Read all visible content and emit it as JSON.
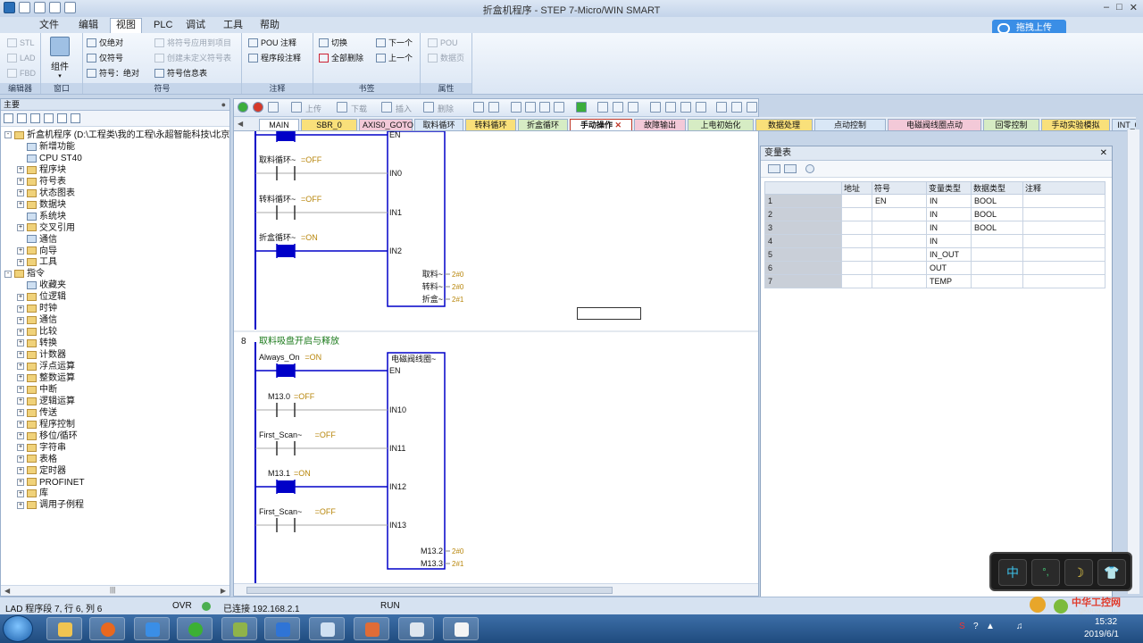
{
  "window": {
    "title": "折盒机程序 - STEP 7-Micro/WIN SMART",
    "minimize_icon": "minimize-icon",
    "maximize_icon": "maximize-icon",
    "close_icon": "close-icon"
  },
  "menu": [
    "文件",
    "编辑",
    "视图",
    "PLC",
    "调试",
    "工具",
    "帮助"
  ],
  "cloud_button": "拖拽上传",
  "ribbon": {
    "editor_group": {
      "label": "编辑器",
      "items": [
        "STL",
        "LAD",
        "FBD"
      ]
    },
    "window_group": {
      "label": "窗口",
      "big": "组件"
    },
    "symbol_group": {
      "label": "符号",
      "items": [
        "仅绝对",
        "仅符号",
        "符号：绝对",
        "将符号应用到项目",
        "创建未定义符号表",
        "符号信息表"
      ]
    },
    "comment_group": {
      "label": "注释",
      "items": [
        "POU 注释",
        "程序段注释"
      ]
    },
    "bookmark_group": {
      "label": "书签",
      "items": [
        "切换",
        "全部删除",
        "下一个",
        "上一个"
      ]
    },
    "property_group": {
      "label": "属性",
      "items": [
        "POU",
        "数据页"
      ]
    }
  },
  "left_panel": {
    "title": "主要",
    "tree": [
      {
        "label": "折盒机程序 (D:\\工程类\\我的工程\\永超智能科技\\北京",
        "level": 0,
        "exp": "-"
      },
      {
        "label": "新增功能",
        "level": 1,
        "exp": ""
      },
      {
        "label": "CPU ST40",
        "level": 1,
        "exp": ""
      },
      {
        "label": "程序块",
        "level": 1,
        "exp": "+"
      },
      {
        "label": "符号表",
        "level": 1,
        "exp": "+"
      },
      {
        "label": "状态图表",
        "level": 1,
        "exp": "+"
      },
      {
        "label": "数据块",
        "level": 1,
        "exp": "+"
      },
      {
        "label": "系统块",
        "level": 1,
        "exp": ""
      },
      {
        "label": "交叉引用",
        "level": 1,
        "exp": "+"
      },
      {
        "label": "通信",
        "level": 1,
        "exp": ""
      },
      {
        "label": "向导",
        "level": 1,
        "exp": "+"
      },
      {
        "label": "工具",
        "level": 1,
        "exp": "+"
      },
      {
        "label": "指令",
        "level": 0,
        "exp": "-"
      },
      {
        "label": "收藏夹",
        "level": 1,
        "exp": ""
      },
      {
        "label": "位逻辑",
        "level": 1,
        "exp": "+"
      },
      {
        "label": "时钟",
        "level": 1,
        "exp": "+"
      },
      {
        "label": "通信",
        "level": 1,
        "exp": "+"
      },
      {
        "label": "比较",
        "level": 1,
        "exp": "+"
      },
      {
        "label": "转换",
        "level": 1,
        "exp": "+"
      },
      {
        "label": "计数器",
        "level": 1,
        "exp": "+"
      },
      {
        "label": "浮点运算",
        "level": 1,
        "exp": "+"
      },
      {
        "label": "整数运算",
        "level": 1,
        "exp": "+"
      },
      {
        "label": "中断",
        "level": 1,
        "exp": "+"
      },
      {
        "label": "逻辑运算",
        "level": 1,
        "exp": "+"
      },
      {
        "label": "传送",
        "level": 1,
        "exp": "+"
      },
      {
        "label": "程序控制",
        "level": 1,
        "exp": "+"
      },
      {
        "label": "移位/循环",
        "level": 1,
        "exp": "+"
      },
      {
        "label": "字符串",
        "level": 1,
        "exp": "+"
      },
      {
        "label": "表格",
        "level": 1,
        "exp": "+"
      },
      {
        "label": "定时器",
        "level": 1,
        "exp": "+"
      },
      {
        "label": "PROFINET",
        "level": 1,
        "exp": "+"
      },
      {
        "label": "库",
        "level": 1,
        "exp": "+"
      },
      {
        "label": "调用子例程",
        "level": 1,
        "exp": "+"
      }
    ]
  },
  "editor_toolbar": {
    "upload": "上传",
    "download": "下载",
    "insert": "插入",
    "delete": "删除"
  },
  "tabs": [
    {
      "label": "MAIN",
      "color": "#ffffff"
    },
    {
      "label": "SBR_0",
      "color": "#f9e07a"
    },
    {
      "label": "AXIS0_GOTO",
      "color": "#f3c9d8"
    },
    {
      "label": "取料循环",
      "color": "#d9e7f6"
    },
    {
      "label": "转料循环",
      "color": "#f9e07a"
    },
    {
      "label": "折盒循环",
      "color": "#d6ecc4"
    },
    {
      "label": "手动操作",
      "color": "#ffffff",
      "active": true
    },
    {
      "label": "故障输出",
      "color": "#f3c9d8"
    },
    {
      "label": "上电初始化",
      "color": "#d6ecc4"
    },
    {
      "label": "数据处理",
      "color": "#f9e07a"
    },
    {
      "label": "点动控制",
      "color": "#d9e7f6"
    },
    {
      "label": "电磁阀线圈点动",
      "color": "#f3c9d8"
    },
    {
      "label": "回零控制",
      "color": "#d6ecc4"
    },
    {
      "label": "手动实验模拟",
      "color": "#f9e07a"
    },
    {
      "label": "INT_0",
      "color": "#d9e7f6"
    }
  ],
  "ladder": {
    "network7": {
      "box_inputs": [
        "EN",
        "IN0",
        "IN1",
        "IN2"
      ],
      "contacts": [
        {
          "label": "取料循环~",
          "state": "=OFF",
          "on": false
        },
        {
          "label": "转料循环~",
          "state": "=OFF",
          "on": false
        },
        {
          "label": "折盒循环~",
          "state": "=ON",
          "on": true
        }
      ],
      "outputs": [
        {
          "label": "取料~",
          "value": "2#0"
        },
        {
          "label": "转料~",
          "value": "2#0"
        },
        {
          "label": "折盒~",
          "value": "2#1"
        }
      ]
    },
    "network8": {
      "number": "8",
      "title": "取料吸盘开启与释放",
      "box_name": "电磁阀线圈~",
      "box_inputs": [
        "EN",
        "IN10",
        "IN11",
        "IN12",
        "IN13"
      ],
      "contacts": [
        {
          "label": "Always_On",
          "state": "=ON",
          "on": true
        },
        {
          "label": "M13.0",
          "state": "=OFF",
          "on": false
        },
        {
          "label": "First_Scan~",
          "state": "=OFF",
          "on": false
        },
        {
          "label": "M13.1",
          "state": "=ON",
          "on": true
        },
        {
          "label": "First_Scan~",
          "state": "=OFF",
          "on": false
        }
      ],
      "outputs": [
        {
          "label": "M13.2",
          "value": "2#0"
        },
        {
          "label": "M13.3",
          "value": "2#1"
        }
      ]
    }
  },
  "var_table": {
    "title": "变量表",
    "headers": [
      "",
      "地址",
      "符号",
      "变量类型",
      "数据类型",
      "注释"
    ],
    "rows": [
      [
        "1",
        "",
        "EN",
        "IN",
        "BOOL",
        ""
      ],
      [
        "2",
        "",
        "",
        "IN",
        "BOOL",
        ""
      ],
      [
        "3",
        "",
        "",
        "IN",
        "BOOL",
        ""
      ],
      [
        "4",
        "",
        "",
        "IN",
        "",
        ""
      ],
      [
        "5",
        "",
        "",
        "IN_OUT",
        "",
        ""
      ],
      [
        "6",
        "",
        "",
        "OUT",
        "",
        ""
      ],
      [
        "7",
        "",
        "",
        "TEMP",
        "",
        ""
      ]
    ]
  },
  "statusbar": {
    "position": "LAD 程序段 7, 行 6, 列 6",
    "mode": "OVR",
    "connection": "已连接 192.168.2.1",
    "plc_state": "RUN"
  },
  "ime": [
    "中",
    "°,",
    "☽",
    "👕"
  ],
  "tray": {
    "time": "15:32",
    "date": "2019/6/1",
    "watermark": "中华工控网",
    "watermark_url": "gkong.com"
  }
}
